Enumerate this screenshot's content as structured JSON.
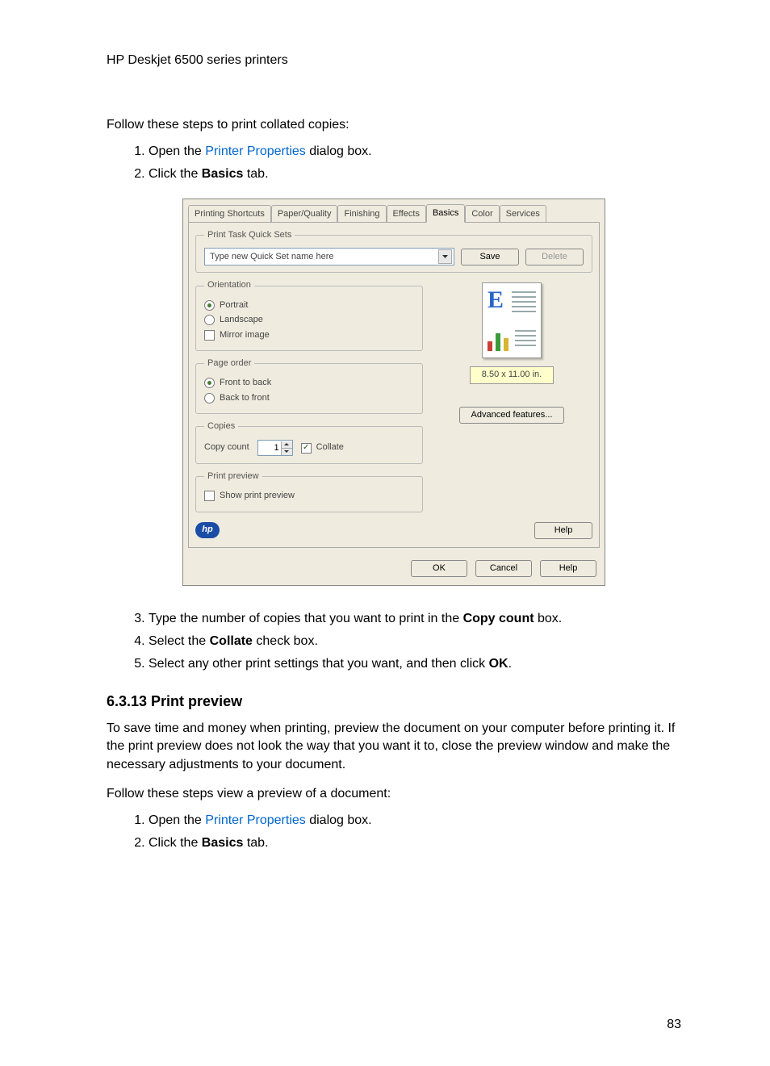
{
  "header": "HP Deskjet 6500 series printers",
  "page_number": "83",
  "intro1": "Follow these steps to print collated copies:",
  "list1": {
    "item1_a": "Open the ",
    "item1_link": "Printer Properties",
    "item1_b": " dialog box.",
    "item2_a": "Click the ",
    "item2_bold": "Basics",
    "item2_b": " tab."
  },
  "list2": {
    "item3_a": "Type the number of copies that you want to print in the ",
    "item3_bold": "Copy count",
    "item3_b": " box.",
    "item4_a": "Select the ",
    "item4_bold": "Collate",
    "item4_b": " check box.",
    "item5_a": "Select any other print settings that you want, and then click ",
    "item5_bold": "OK",
    "item5_b": "."
  },
  "section_heading": "6.3.13  Print preview",
  "section_para": "To save time and money when printing, preview the document on your computer before printing it. If the print preview does not look the way that you want it to, close the preview window and make the necessary adjustments to your document.",
  "intro2": "Follow these steps view a preview of a document:",
  "list3": {
    "item1_a": "Open the ",
    "item1_link": "Printer Properties",
    "item1_b": " dialog box.",
    "item2_a": "Click the ",
    "item2_bold": "Basics",
    "item2_b": " tab."
  },
  "dialog": {
    "tabs": {
      "t1": "Printing Shortcuts",
      "t2": "Paper/Quality",
      "t3": "Finishing",
      "t4": "Effects",
      "t5": "Basics",
      "t6": "Color",
      "t7": "Services"
    },
    "quicksets": {
      "legend": "Print Task Quick Sets",
      "value": "Type new Quick Set name here",
      "save": "Save",
      "delete": "Delete"
    },
    "orientation": {
      "legend": "Orientation",
      "portrait": "Portrait",
      "landscape": "Landscape",
      "mirror": "Mirror image"
    },
    "pageorder": {
      "legend": "Page order",
      "front": "Front to back",
      "back": "Back to front"
    },
    "copies": {
      "legend": "Copies",
      "count_label": "Copy count",
      "count_value": "1",
      "collate": "Collate"
    },
    "printpreview": {
      "legend": "Print preview",
      "show": "Show print preview"
    },
    "preview_dim": "8.50 x 11.00 in.",
    "advanced": "Advanced features...",
    "help_inside": "Help",
    "hp_logo": "hp",
    "footer": {
      "ok": "OK",
      "cancel": "Cancel",
      "help": "Help"
    }
  }
}
